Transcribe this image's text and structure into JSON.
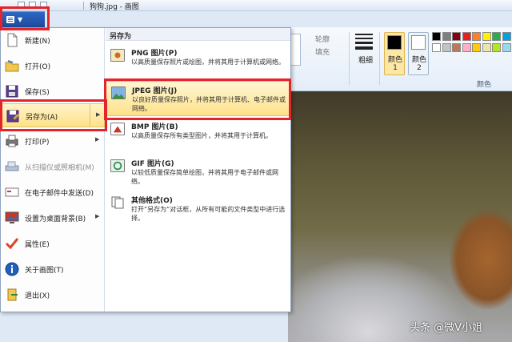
{
  "window": {
    "title": "狗狗.jpg - 画图"
  },
  "app_menu": {
    "items": [
      {
        "label": "新建(N)"
      },
      {
        "label": "打开(O)"
      },
      {
        "label": "保存(S)"
      },
      {
        "label": "另存为(A)"
      },
      {
        "label": "打印(P)"
      },
      {
        "label": "从扫描仪或照相机(M)"
      },
      {
        "label": "在电子邮件中发送(D)"
      },
      {
        "label": "设置为桌面背景(B)"
      },
      {
        "label": "属性(E)"
      },
      {
        "label": "关于画图(T)"
      },
      {
        "label": "退出(X)"
      }
    ]
  },
  "save_as": {
    "header": "另存为",
    "formats": [
      {
        "title": "PNG 图片(P)",
        "desc": "以高质量保存照片或绘图，并将其用于计算机或网络。"
      },
      {
        "title": "JPEG 图片(J)",
        "desc": "以良好质量保存照片，并将其用于计算机、电子邮件或网络。"
      },
      {
        "title": "BMP 图片(B)",
        "desc": "以高质量保存所有类型图片，并将其用于计算机。"
      },
      {
        "title": "GIF 图片(G)",
        "desc": "以较低质量保存简单绘图，并将其用于电子邮件或网络。"
      },
      {
        "title": "其他格式(O)",
        "desc": "打开“另存为”对话框，从所有可能的文件类型中进行选择。"
      }
    ]
  },
  "ribbon": {
    "outline_label": "轮廓",
    "fill_label": "填充",
    "size_label": "粗细",
    "color1_label": "颜色 1",
    "color2_label": "颜色 2",
    "colors_group_label": "颜色"
  },
  "colors": {
    "color1": "#000000",
    "color2": "#ffffff",
    "palette_row1": [
      "#000000",
      "#7f7f7f",
      "#880015",
      "#ed1c24",
      "#ff7f27",
      "#fff200",
      "#22b14c",
      "#00a2e8"
    ],
    "palette_row2": [
      "#ffffff",
      "#c3c3c3",
      "#b97a57",
      "#ffaec9",
      "#ffc90e",
      "#efe4b0",
      "#b5e61d",
      "#99d9ea"
    ],
    "highlight_red": "#e4242b",
    "hover_bg": "#fde18a"
  },
  "watermark": {
    "text": "头条 @微V小姐"
  }
}
